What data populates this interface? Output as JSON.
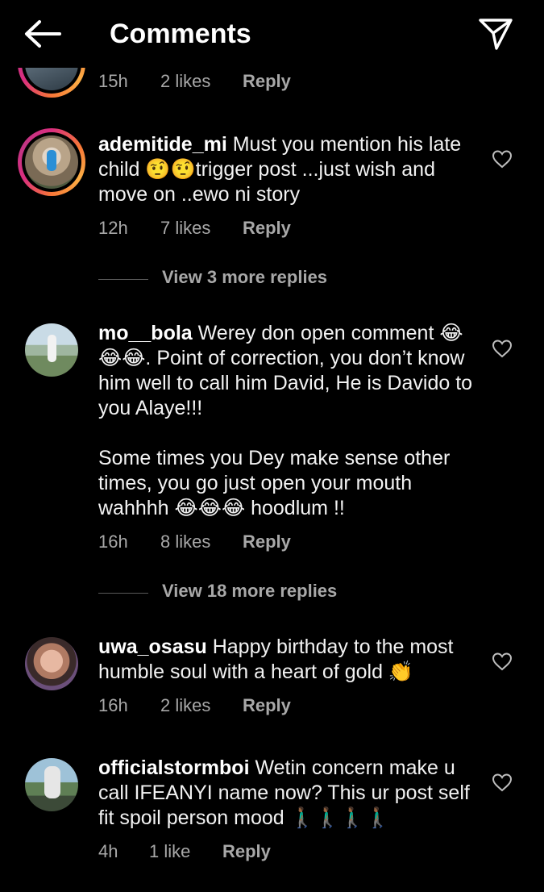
{
  "header": {
    "title": "Comments",
    "back_icon": "arrow-left-icon",
    "share_icon": "paper-plane-icon"
  },
  "partial_comment": {
    "time": "15h",
    "likes": "2 likes",
    "reply": "Reply"
  },
  "comments": [
    {
      "username": "ademitide_mi",
      "text": " Must you mention his late child 🤨🤨trigger post ...just wish and move on ..ewo ni story",
      "time": "12h",
      "likes": "7 likes",
      "reply": "Reply",
      "view_replies": "View 3 more replies"
    },
    {
      "username": "mo__bola",
      "text": " Werey don open comment 😂😂😂. Point of correction, you don’t know him well to call him David, He is Davido to you Alaye!!!\n\nSome times you Dey make sense other times, you go just open your mouth wahhhh 😂😂😂 hoodlum !!",
      "time": "16h",
      "likes": "8 likes",
      "reply": "Reply",
      "view_replies": "View 18 more replies"
    },
    {
      "username": "uwa_osasu",
      "text": " Happy birthday to the most humble soul with a heart of gold 👏",
      "time": "16h",
      "likes": "2 likes",
      "reply": "Reply"
    },
    {
      "username": "officialstormboi",
      "text": " Wetin concern make u call IFEANYI name now? This ur post self fit spoil person mood 🚶🏾‍♂️🚶🏾‍♂️🚶🏾‍♂️🚶🏾‍♂️",
      "time": "4h",
      "likes": "1 like",
      "reply": "Reply"
    }
  ],
  "icons": {
    "like": "heart-outline-icon"
  },
  "colors": {
    "background": "#000000",
    "text": "#ffffff",
    "secondary": "#a8a8a8",
    "story_ring": "#d92e7f"
  }
}
